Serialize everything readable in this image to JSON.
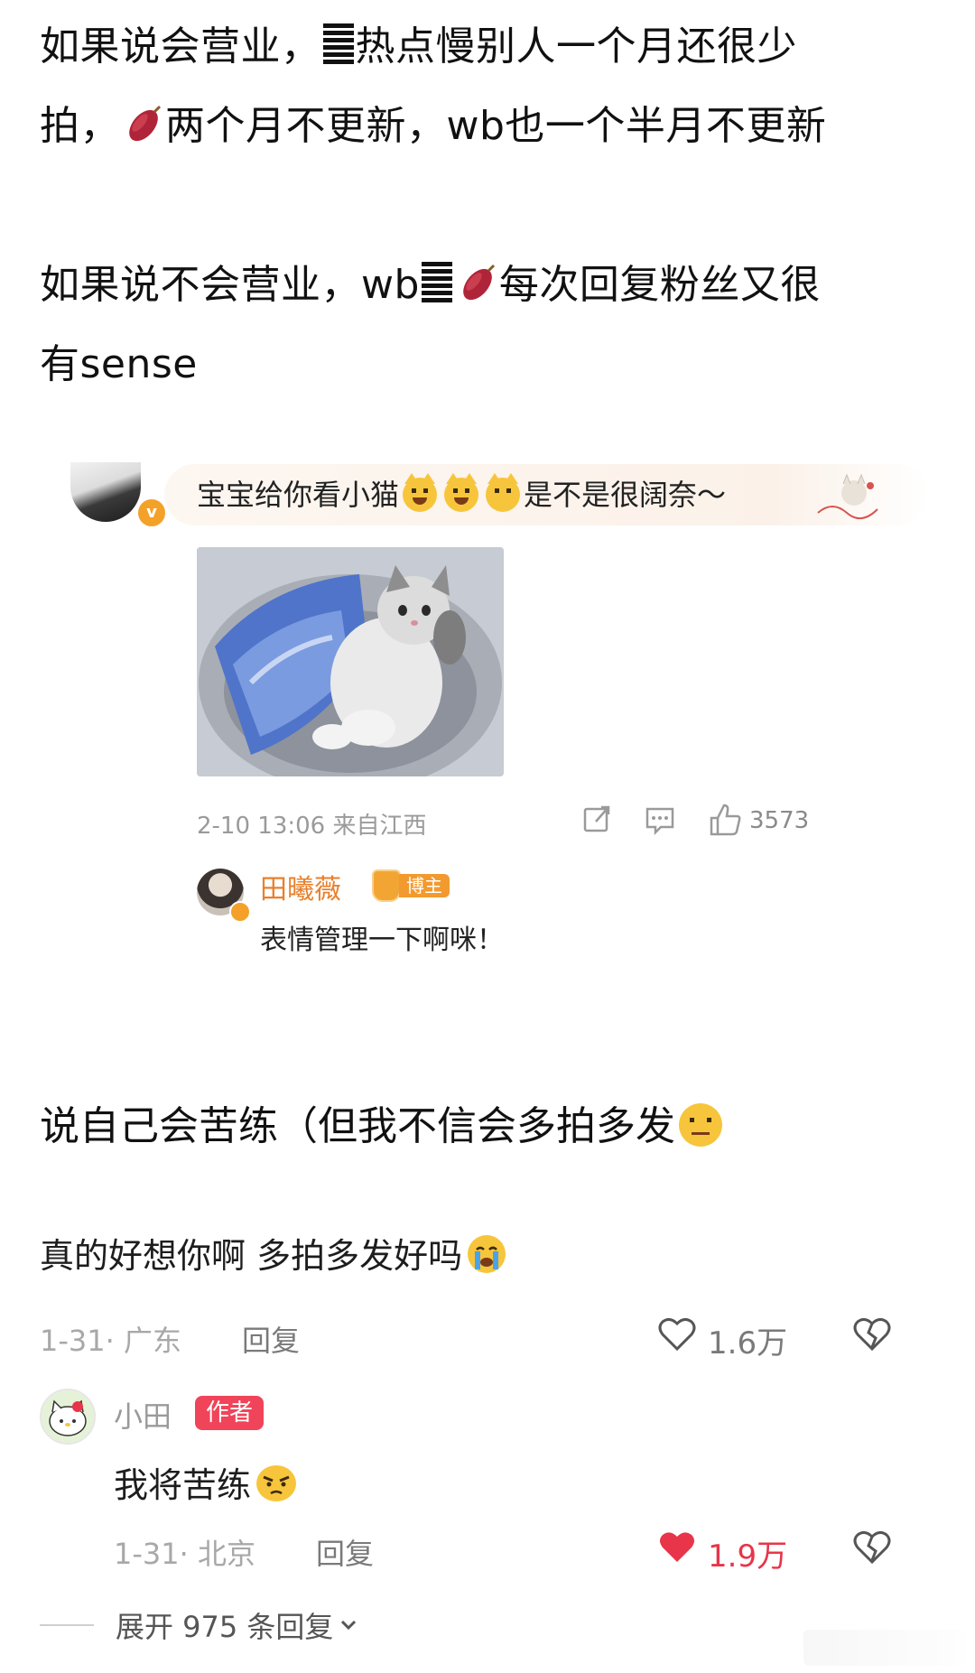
{
  "intro": {
    "line1_a": "如果说会营业，",
    "line1_b": "热点慢别人一个月还很少",
    "line2_a": "拍，",
    "line2_b": "两个月不更新，wb也一个半月不更新",
    "line3_a": "如果说不会营业，wb",
    "line3_b": "每次回复粉丝又很",
    "line4": "有sense"
  },
  "weibo_card": {
    "comment_a": "宝宝给你看小猫",
    "comment_b": "是不是很阔奈～",
    "timestamp": "2-10 13:06 来自江西",
    "like_count": "3573",
    "reply": {
      "name": "田曦薇",
      "badge": "博主",
      "text": "表情管理一下啊咪！"
    }
  },
  "middle": {
    "text": "说自己会苦练（但我不信会多拍多发"
  },
  "xhs_comment": {
    "text": "真的好想你啊 多拍多发好吗",
    "date": "1-31· 广东",
    "reply_label": "回复",
    "like_count": "1.6万",
    "reply": {
      "name": "小田",
      "badge": "作者",
      "text": "我将苦练",
      "date": "1-31· 北京",
      "reply_label": "回复",
      "like_count": "1.9万"
    },
    "expand_label": "展开 975 条回复"
  },
  "colors": {
    "liked_red": "#e8354a",
    "weibo_orange": "#e8802c",
    "author_badge": "#f0445a"
  }
}
